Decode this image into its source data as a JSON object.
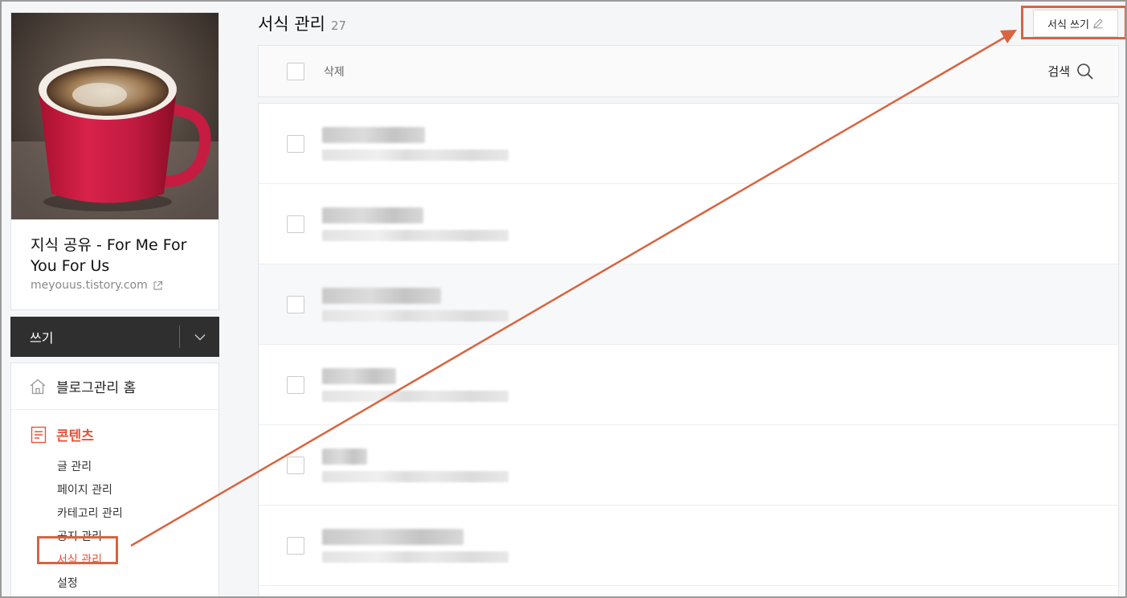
{
  "sidebar": {
    "blog_title": "지식 공유 - For Me For You For Us",
    "blog_url": "meyouus.tistory.com",
    "write_label": "쓰기",
    "home_label": "블로그관리 홈",
    "contents_label": "콘텐츠",
    "submenu": [
      {
        "label": "글 관리"
      },
      {
        "label": "페이지 관리"
      },
      {
        "label": "카테고리 관리"
      },
      {
        "label": "공지 관리"
      },
      {
        "label": "서식 관리"
      },
      {
        "label": "설정"
      }
    ],
    "active_index": 4
  },
  "header": {
    "title": "서식 관리",
    "count": "27",
    "new_button_label": "서식 쓰기"
  },
  "toolbar": {
    "delete_label": "삭제",
    "search_label": "검색"
  },
  "list": {
    "rows": [
      {
        "title": "",
        "meta": ""
      },
      {
        "title": "",
        "meta": ""
      },
      {
        "title": "",
        "meta": ""
      },
      {
        "title": "",
        "meta": ""
      },
      {
        "title": "",
        "meta": ""
      },
      {
        "title": "",
        "meta": ""
      }
    ]
  },
  "colors": {
    "accent": "#eb5237",
    "annotation": "#d9643f",
    "write_bar": "#2f2f2f"
  },
  "icons": {
    "home": "home-icon",
    "contents": "document-icon",
    "external": "external-link-icon",
    "chevron": "chevron-down-icon",
    "search": "search-icon",
    "pencil": "pencil-icon"
  }
}
